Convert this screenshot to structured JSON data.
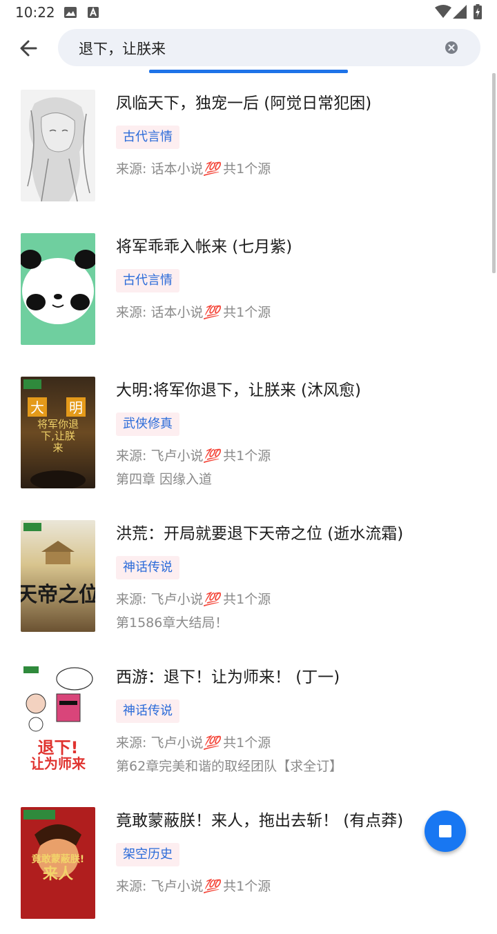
{
  "status_bar": {
    "time": "10:22"
  },
  "search": {
    "query": "退下，让朕来"
  },
  "results": [
    {
      "title": "凤临天下，独宠一后 (阿觉日常犯困)",
      "tag": "古代言情",
      "source_prefix": "来源: 话本小说",
      "source_emoji": "💯",
      "source_count": "共1个源",
      "latest": ""
    },
    {
      "title": "将军乖乖入帐来 (七月紫)",
      "tag": "古代言情",
      "source_prefix": "来源: 话本小说",
      "source_emoji": "💯",
      "source_count": "共1个源",
      "latest": ""
    },
    {
      "title": "大明:将军你退下，让朕来 (沐风愈)",
      "tag": "武侠修真",
      "source_prefix": "来源: 飞卢小说",
      "source_emoji": "💯",
      "source_count": "共1个源",
      "latest": "第四章 因缘入道"
    },
    {
      "title": "洪荒：开局就要退下天帝之位 (逝水流霜)",
      "tag": "神话传说",
      "source_prefix": "来源: 飞卢小说",
      "source_emoji": "💯",
      "source_count": "共1个源",
      "latest": "第1586章大结局！"
    },
    {
      "title": "西游：退下！让为师来！ (丁一)",
      "tag": "神话传说",
      "source_prefix": "来源: 飞卢小说",
      "source_emoji": "💯",
      "source_count": "共1个源",
      "latest": "第62章完美和谐的取经团队【求全订】"
    },
    {
      "title": "竟敢蒙蔽朕！来人，拖出去斩！ (有点莽)",
      "tag": "架空历史",
      "source_prefix": "来源: 飞卢小说",
      "source_emoji": "💯",
      "source_count": "共1个源",
      "latest": ""
    }
  ],
  "colors": {
    "accent": "#1877f2",
    "tag_bg": "#fdeef0",
    "tag_text": "#2a6bd9"
  }
}
